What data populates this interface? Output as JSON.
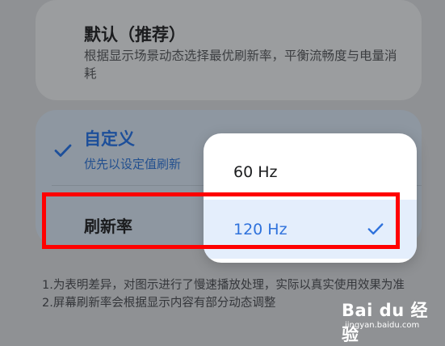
{
  "options_card_default": {
    "title": "默认（推荐）",
    "description": "根据显示场景动态选择最优刷新率，平衡流畅度与电量消耗"
  },
  "options_card_custom": {
    "title": "自定义",
    "description": "优先以设定值刷新"
  },
  "refresh_rate": {
    "label": "刷新率"
  },
  "dropdown": {
    "options": [
      {
        "label": "60 Hz",
        "selected": false
      },
      {
        "label": "120 Hz",
        "selected": true
      }
    ]
  },
  "notes": {
    "line1": "1.为表明差异，对图示进行了慢速播放处理，实际以真实使用效果为准",
    "line2": "2.屏幕刷新率会根据显示内容有部分动态调整"
  },
  "watermark": {
    "brand": "Bai du 经验",
    "url": "jingyan.baidu.com"
  },
  "colors": {
    "accent": "#2f72dc",
    "highlight_box": "#ff0000",
    "selected_bg": "#e4eefc"
  }
}
